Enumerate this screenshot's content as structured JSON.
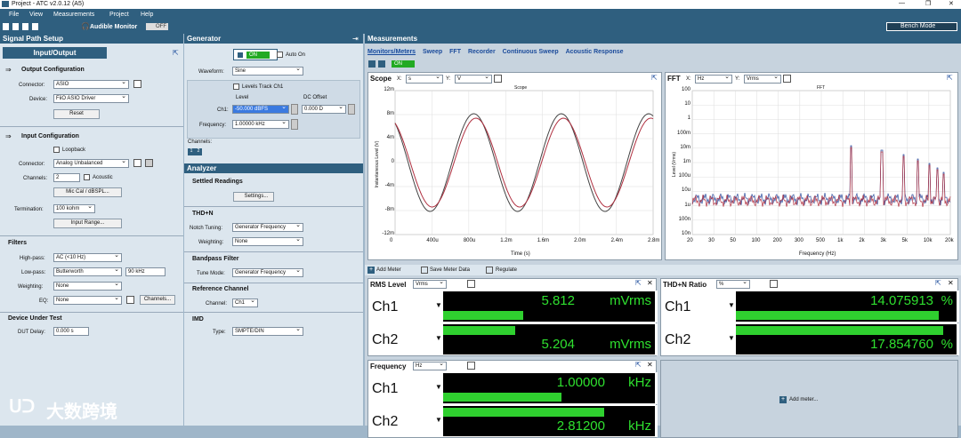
{
  "window": {
    "title": "Project - ATC v2.0.12 (A5)"
  },
  "menu": [
    "File",
    "View",
    "Measurements",
    "Project",
    "Help"
  ],
  "toolbar": {
    "audible_monitor": "Audible Monitor",
    "audible_state": "OFF",
    "bench_mode": "Bench Mode"
  },
  "signal_path": {
    "title": "Signal Path Setup",
    "selector": "Input/Output",
    "output": {
      "title": "Output Configuration",
      "connector_label": "Connector:",
      "connector": "ASIO",
      "device_label": "Device:",
      "device": "FiiO ASIO Driver",
      "reset": "Reset"
    },
    "input": {
      "title": "Input Configuration",
      "loopback": "Loopback",
      "connector_label": "Connector:",
      "connector": "Analog Unbalanced",
      "channels_label": "Channels:",
      "channels": "2",
      "acoustic": "Acoustic",
      "mic_cal": "Mic Cal / dBSPL...",
      "termination_label": "Termination:",
      "termination": "100 kohm",
      "input_range": "Input Range..."
    },
    "filters": {
      "title": "Filters",
      "highpass_label": "High-pass:",
      "highpass": "AC (<10 Hz)",
      "lowpass_label": "Low-pass:",
      "lowpass": "Butterworth",
      "lowpass_freq": "90 kHz",
      "weighting_label": "Weighting:",
      "weighting": "None",
      "eq_label": "EQ:",
      "eq": "None",
      "channels_btn": "Channels..."
    },
    "dut": {
      "title": "Device Under Test",
      "delay_label": "DUT Delay:",
      "delay": "0.000 s"
    }
  },
  "generator": {
    "title": "Generator",
    "on": "ON",
    "auto_on": "Auto On",
    "waveform_label": "Waveform:",
    "waveform": "Sine",
    "levels_track": "Levels Track Ch1",
    "level_label": "Level",
    "dc_label": "DC Offset",
    "ch1_label": "Ch1:",
    "ch1_level": "-50.000 dBFS",
    "dc_value": "0.000 D",
    "freq_label": "Frequency:",
    "freq": "1.00000 kHz",
    "channels_label": "Channels:"
  },
  "analyzer": {
    "title": "Analyzer",
    "settled": "Settled Readings",
    "settings_btn": "Settings...",
    "thdn": "THD+N",
    "notch_label": "Notch Tuning:",
    "notch": "Generator Frequency",
    "weight_label": "Weighting:",
    "weight": "None",
    "bandpass": "Bandpass Filter",
    "tune_label": "Tune Mode:",
    "tune": "Generator Frequency",
    "refch": "Reference Channel",
    "channel_label": "Channel:",
    "channel": "Ch1",
    "imd": "IMD",
    "type_label": "Type:",
    "type": "SMPTE/DIN"
  },
  "measurements": {
    "title": "Measurements",
    "tabs": [
      "Monitors/Meters",
      "Sweep",
      "FFT",
      "Recorder",
      "Continuous Sweep",
      "Acoustic Response"
    ],
    "on": "ON"
  },
  "scope": {
    "title": "Scope",
    "x_label": "X:",
    "x_unit": "s",
    "y_label": "Y:",
    "y_unit": "V",
    "plot_title": "Scope",
    "ylabel": "Instantaneous Level (V)",
    "xlabel": "Time (s)",
    "yticks": [
      "12m",
      "8m",
      "4m",
      "0",
      "-4m",
      "-8m",
      "-12m"
    ],
    "xticks": [
      "0",
      "400u",
      "800u",
      "1.2m",
      "1.6m",
      "2.0m",
      "2.4m",
      "2.8m"
    ]
  },
  "fft": {
    "title": "FFT",
    "x_label": "X:",
    "x_unit": "Hz",
    "y_label": "Y:",
    "y_unit": "Vrms",
    "plot_title": "FFT",
    "ylabel": "Level (Vrms)",
    "xlabel": "Frequency (Hz)",
    "yticks": [
      "100",
      "10",
      "1",
      "100m",
      "10m",
      "1m",
      "100u",
      "10u",
      "1u",
      "100n",
      "10n"
    ],
    "xticks": [
      "20",
      "30",
      "50",
      "100",
      "200",
      "300",
      "500",
      "1k",
      "2k",
      "3k",
      "5k",
      "10k",
      "20k"
    ]
  },
  "meters_toolbar": {
    "add_meter": "Add Meter",
    "save": "Save Meter Data",
    "regulate": "Regulate"
  },
  "rms": {
    "title": "RMS Level",
    "unit_select": "Vrms",
    "rows": [
      {
        "ch": "Ch1",
        "value": "5.812",
        "unit": "mVrms",
        "fill": 0.38
      },
      {
        "ch": "Ch2",
        "value": "5.204",
        "unit": "mVrms",
        "fill": 0.34
      }
    ]
  },
  "thdn_meter": {
    "title": "THD+N Ratio",
    "unit_select": "%",
    "rows": [
      {
        "ch": "Ch1",
        "value": "14.075913",
        "unit": "%",
        "fill": 0.92
      },
      {
        "ch": "Ch2",
        "value": "17.854760",
        "unit": "%",
        "fill": 0.94
      }
    ]
  },
  "freq_meter": {
    "title": "Frequency",
    "unit_select": "Hz",
    "rows": [
      {
        "ch": "Ch1",
        "value": "1.00000",
        "unit": "kHz",
        "fill": 0.56
      },
      {
        "ch": "Ch2",
        "value": "2.81200",
        "unit": "kHz",
        "fill": 0.76
      }
    ]
  },
  "add_meter_panel": {
    "label": "Add meter..."
  },
  "watermark": "大数跨境"
}
